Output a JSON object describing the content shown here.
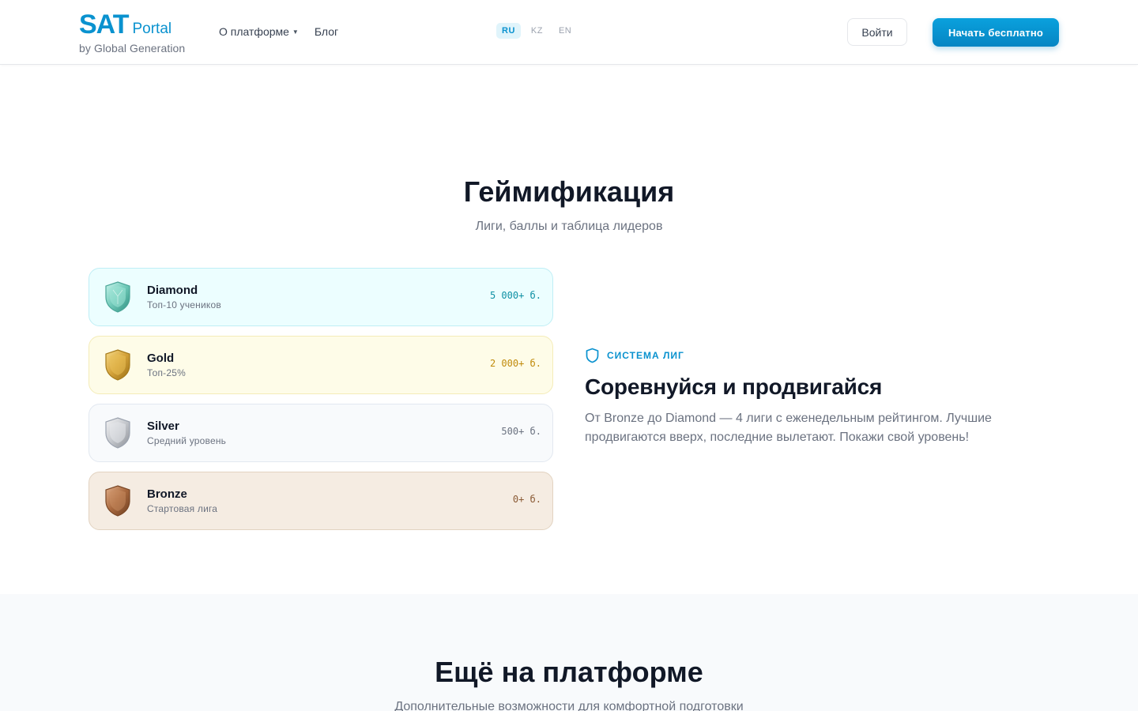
{
  "header": {
    "logo": {
      "main": "SAT",
      "sub": "Portal",
      "byline": "by Global Generation"
    },
    "nav": [
      {
        "label": "О платформе",
        "has_dropdown": true
      },
      {
        "label": "Блог"
      }
    ],
    "languages": [
      {
        "code": "RU",
        "active": true
      },
      {
        "code": "KZ",
        "active": false
      },
      {
        "code": "EN",
        "active": false
      }
    ],
    "login_label": "Войти",
    "start_label": "Начать бесплатно",
    "dropdown_icon": "chevron-down-icon"
  },
  "gamification": {
    "title": "Геймификация",
    "subtitle": "Лиги, баллы и таблица лидеров",
    "leagues": [
      {
        "name": "Diamond",
        "desc": "Топ-10 учеников",
        "points": "5 000+ б.",
        "icon": "diamond-shield-icon",
        "color": "#0e8fa3"
      },
      {
        "name": "Gold",
        "desc": "Топ-25%",
        "points": "2 000+ б.",
        "icon": "gold-shield-icon",
        "color": "#c08a0a"
      },
      {
        "name": "Silver",
        "desc": "Средний уровень",
        "points": "500+ б.",
        "icon": "silver-shield-icon",
        "color": "#6b7280"
      },
      {
        "name": "Bronze",
        "desc": "Стартовая лига",
        "points": "0+ б.",
        "icon": "bronze-shield-icon",
        "color": "#8a5a35"
      }
    ],
    "feature": {
      "label": "СИСТЕМА ЛИГ",
      "icon": "shield-icon",
      "title": "Соревнуйся и продвигайся",
      "text": "От Bronze до Diamond — 4 лиги с еженедельным рейтингом. Лучшие продвигаются вверх, последние вылетают. Покажи свой уровень!"
    }
  },
  "more": {
    "title": "Ещё на платформе",
    "subtitle": "Дополнительные возможности для комфортной подготовки"
  },
  "colors": {
    "accent": "#0a92cf",
    "text": "#111827",
    "muted": "#6b7280"
  }
}
